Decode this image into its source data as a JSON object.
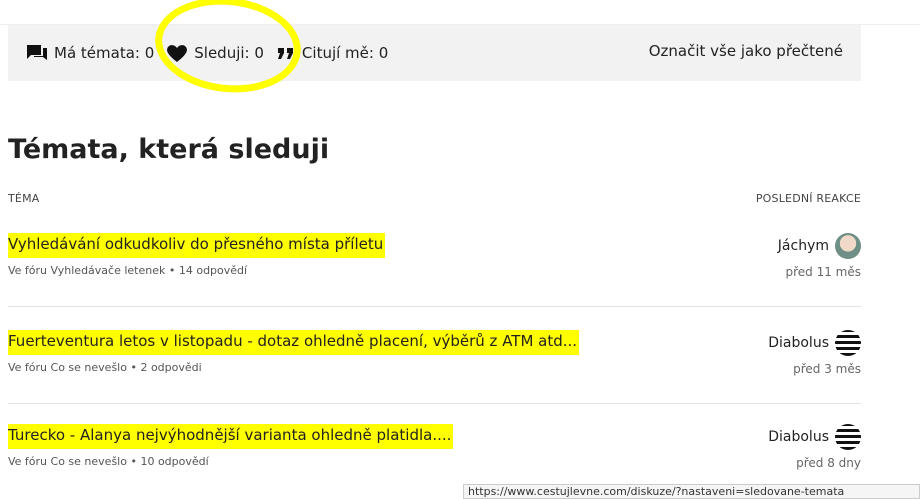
{
  "filters": {
    "my_topics": "Má témata: 0",
    "following": "Sleduji: 0",
    "quoting_me": "Citují mě: 0",
    "mark_all_read": "Označit vše jako přečtené"
  },
  "page_title": "Témata, která sleduji",
  "columns": {
    "topic": "TÉMA",
    "last_reply": "POSLEDNÍ REAKCE"
  },
  "topics": [
    {
      "title": "Vyhledávání odkudkoliv do přesného místa příletu",
      "meta": "Ve fóru Vyhledávače letenek • 14 odpovědí",
      "user": "Jáchym",
      "time": "před 11 měs"
    },
    {
      "title": "Fuerteventura letos v listopadu - dotaz ohledně placení, výběrů z ATM atd...",
      "meta": "Ve fóru Co se nevešlo • 2 odpovědi",
      "user": "Diabolus",
      "time": "před 3 měs"
    },
    {
      "title": "Turecko - Alanya nejvýhodnější varianta ohledně platidla....",
      "meta": "Ve fóru Co se nevešlo • 10 odpovědí",
      "user": "Diabolus",
      "time": "před 8 dny"
    }
  ],
  "status_url": "https://www.cestujlevne.com/diskuze/?nastaveni=sledovane-temata",
  "colors": {
    "highlight": "#ffff00",
    "filter_bg": "#f2f2f2"
  },
  "icons": [
    "chat-icon",
    "heart-icon",
    "quote-icon"
  ]
}
